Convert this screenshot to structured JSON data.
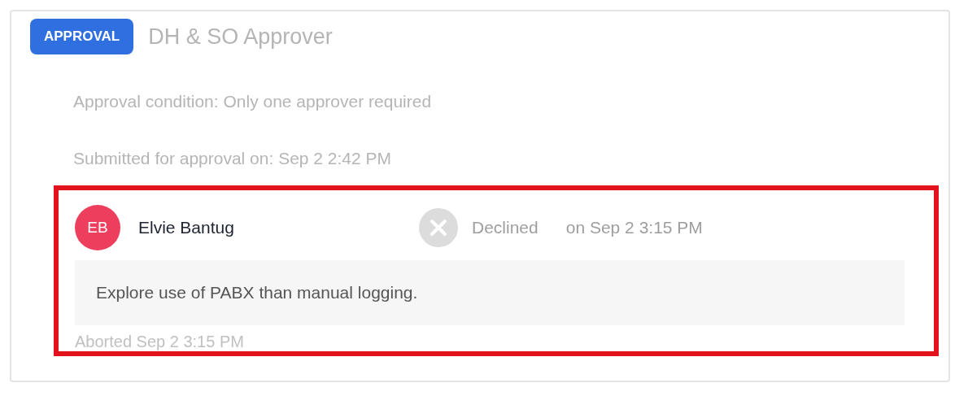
{
  "step": {
    "badge": "APPROVAL",
    "title": "DH & SO Approver"
  },
  "condition": "Approval condition: Only one approver required",
  "submitted": "Submitted for approval on: Sep 2 2:42 PM",
  "highlighted": true,
  "response": {
    "initials": "EB",
    "color": "#ee3e5e",
    "name": "Elvie Bantug",
    "kind": "declined",
    "status": "Declined",
    "time": "on Sep 2 3:15 PM",
    "comment": "Explore use of PABX than manual logging.",
    "aborted": "Aborted Sep 2 3:15 PM"
  }
}
